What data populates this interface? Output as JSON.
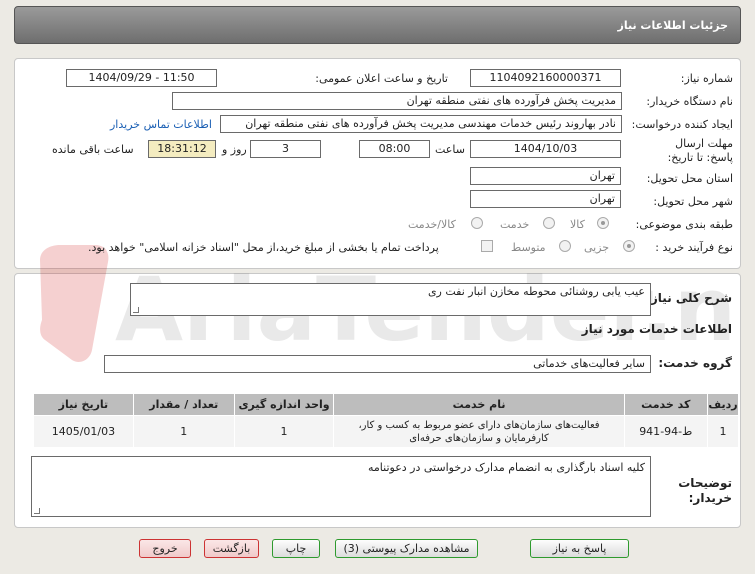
{
  "title": "جزئیات اطلاعات نیاز",
  "fields": {
    "need_number_label": "شماره نیاز:",
    "need_number": "1104092160000371",
    "announce_label": "تاریخ و ساعت اعلان عمومی:",
    "announce_value": "1404/09/29 - 11:50",
    "buyer_label": "نام دستگاه خریدار:",
    "buyer_value": "مدیریت پخش فرآورده های نفتی منطقه تهران",
    "creator_label": "ایجاد کننده درخواست:",
    "creator_value": "نادر بهاروند رئیس خدمات مهندسی مدیریت پخش فرآورده های نفتی منطقه تهران",
    "contact_link": "اطلاعات تماس خریدار",
    "deadline_label": "مهلت ارسال پاسخ: تا تاریخ:",
    "deadline_date": "1404/10/03",
    "time_label": "ساعت",
    "deadline_time": "08:00",
    "days_value": "3",
    "days_label": "روز و",
    "remaining_time": "18:31:12",
    "remaining_label": "ساعت باقی مانده",
    "province_label": "استان محل تحویل:",
    "province_value": "تهران",
    "city_label": "شهر محل تحویل:",
    "city_value": "تهران",
    "category_label": "طبقه بندی موضوعی:",
    "category_options": [
      "کالا",
      "خدمت",
      "کالا/خدمت"
    ],
    "process_label": "نوع فرآیند خرید :",
    "process_options": [
      "جزیی",
      "متوسط"
    ],
    "payment_note": "پرداخت تمام یا بخشی از مبلغ خرید،از محل \"اسناد خزانه اسلامی\" خواهد بود."
  },
  "description": {
    "label": "شرح کلی نیاز:",
    "value": "عیب یابی روشنائی محوطه مخازن انبار نفت ری"
  },
  "services": {
    "section_title": "اطلاعات خدمات مورد نیاز",
    "group_label": "گروه خدمت:",
    "group_value": "سایر فعالیت‌های خدماتی",
    "columns": [
      "ردیف",
      "کد خدمت",
      "نام خدمت",
      "واحد اندازه گیری",
      "تعداد / مقدار",
      "تاریخ نیاز"
    ],
    "rows": [
      [
        "1",
        "ط-94-941",
        "فعالیت‌های سازمان‌های دارای عضو مربوط به کسب و کار، کارفرمایان و سازمان‌های حرفه‌ای",
        "1",
        "1",
        "1405/01/03"
      ]
    ]
  },
  "notes": {
    "label": "توضیحات خریدار:",
    "value": "کلیه اسناد بارگذاری به انضمام مدارک درخواستی در دعوتنامه"
  },
  "buttons": {
    "reply": "پاسخ به نیاز",
    "attachments": "مشاهده مدارک پیوستی (3)",
    "print": "چاپ",
    "back": "بازگشت",
    "exit": "خروج"
  },
  "watermark": "AriaTender.net"
}
